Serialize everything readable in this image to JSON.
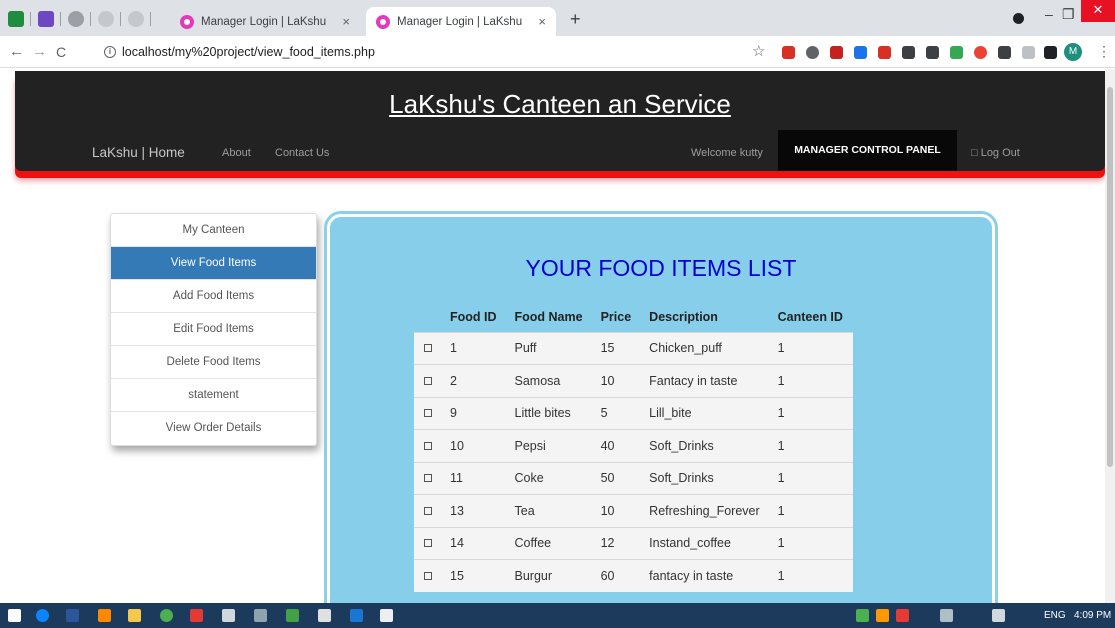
{
  "browser": {
    "tabs": [
      {
        "title": "Manager Login | LaKshu",
        "active": false
      },
      {
        "title": "Manager Login | LaKshu",
        "active": true
      }
    ],
    "new_tab": "+",
    "tab_close": "×",
    "url": "localhost/my%20project/view_food_items.php",
    "nav": {
      "back": "←",
      "forward": "→",
      "reload": "C"
    },
    "profile_initial": "M"
  },
  "site": {
    "title": "LaKshu's Canteen an Service",
    "brand": "LaKshu | Home",
    "nav": [
      "About",
      "Contact Us"
    ],
    "welcome": "Welcome kutty",
    "control_panel": "MANAGER CONTROL PANEL",
    "logout": "□ Log Out"
  },
  "sidebar": {
    "items": [
      {
        "label": "My Canteen"
      },
      {
        "label": "View Food Items",
        "active": true
      },
      {
        "label": "Add Food Items"
      },
      {
        "label": "Edit Food Items"
      },
      {
        "label": "Delete Food Items"
      },
      {
        "label": "statement"
      },
      {
        "label": "View Order Details"
      }
    ]
  },
  "main": {
    "heading": "YOUR FOOD ITEMS LIST",
    "columns": [
      "Food ID",
      "Food Name",
      "Price",
      "Description",
      "Canteen ID"
    ],
    "rows": [
      [
        "1",
        "Puff",
        "15",
        "Chicken_puff",
        "1"
      ],
      [
        "2",
        "Samosa",
        "10",
        "Fantacy in taste",
        "1"
      ],
      [
        "9",
        "Little bites",
        "5",
        "Lill_bite",
        "1"
      ],
      [
        "10",
        "Pepsi",
        "40",
        "Soft_Drinks",
        "1"
      ],
      [
        "11",
        "Coke",
        "50",
        "Soft_Drinks",
        "1"
      ],
      [
        "13",
        "Tea",
        "10",
        "Refreshing_Forever",
        "1"
      ],
      [
        "14",
        "Coffee",
        "12",
        "Instand_coffee",
        "1"
      ],
      [
        "15",
        "Burgur",
        "60",
        "fantacy in taste",
        "1"
      ]
    ]
  },
  "taskbar": {
    "language": "ENG",
    "time": "4:09 PM"
  },
  "colors": {
    "header_bg": "#222222",
    "header_accent": "#ee1111",
    "active_sidebar": "#337ab7",
    "panel_bg": "#87ceeb",
    "heading": "#0000cc"
  }
}
